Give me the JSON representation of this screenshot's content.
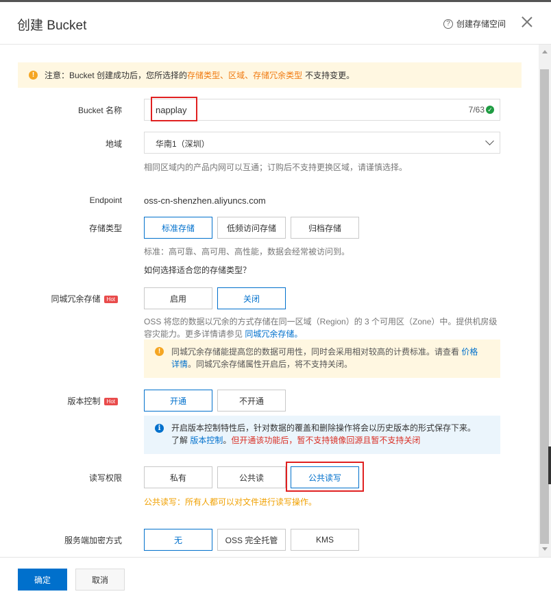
{
  "dialog": {
    "title": "创建 Bucket",
    "help_link": "创建存储空间",
    "help_icon": "?"
  },
  "notice": {
    "prefix": "注意：Bucket 创建成功后，您所选择的",
    "term1": "存储类型",
    "sep1": "、",
    "term2": "区域",
    "sep2": "、",
    "term3": "存储冗余类型",
    "suffix": "不支持变更。"
  },
  "bucket_name": {
    "label": "Bucket 名称",
    "value": "napplay",
    "counter": "7/63"
  },
  "region": {
    "label": "地域",
    "selected": "华南1（深圳）",
    "hint": "相同区域内的产品内网可以互通；订购后不支持更换区域，请谨慎选择。"
  },
  "endpoint": {
    "label": "Endpoint",
    "value": "oss-cn-shenzhen.aliyuncs.com"
  },
  "storage_class": {
    "label": "存储类型",
    "options": [
      "标准存储",
      "低频访问存储",
      "归档存储"
    ],
    "selected": "标准存储",
    "hint": "标准：高可靠、高可用、高性能，数据会经常被访问到。",
    "link": "如何选择适合您的存储类型？"
  },
  "zone_redundancy": {
    "label": "同城冗余存储",
    "hot": "Hot",
    "options": [
      "启用",
      "关闭"
    ],
    "selected": "关闭",
    "desc_line1": "OSS 将您的数据以冗余的方式存储在同一区域（Region）的 3 个可用区（Zone）中。提供机房级",
    "desc_line2": "容灾能力。更多详情请参见",
    "desc_link": "同城冗余存储。",
    "warn_text1": "同城冗余存储能提高您的数据可用性，同时会采用相对较高的计费标准。请查看",
    "warn_link1": "价格",
    "warn_link2": "详情",
    "warn_text2": "。同城冗余存储属性开启后，将不支持关闭。"
  },
  "versioning": {
    "label": "版本控制",
    "hot": "Hot",
    "options": [
      "开通",
      "不开通"
    ],
    "selected": "开通",
    "info_line1": "开启版本控制特性后，针对数据的覆盖和删除操作将会以历史版本的形式保存下来。",
    "info_prefix": "了解",
    "info_link": "版本控制",
    "info_sep": "。",
    "info_red": "但开通该功能后，暂不支持镜像回源且暂不支持关闭"
  },
  "acl": {
    "label": "读写权限",
    "options": [
      "私有",
      "公共读",
      "公共读写"
    ],
    "selected": "公共读写",
    "hint": "公共读写：所有人都可以对文件进行读写操作。"
  },
  "encryption": {
    "label": "服务端加密方式",
    "options": [
      "无",
      "OSS 完全托管",
      "KMS"
    ],
    "selected": "无"
  },
  "footer": {
    "confirm": "确定",
    "cancel": "取消"
  },
  "icons": {
    "warning": "!",
    "info": "i",
    "check": "✓"
  },
  "colors": {
    "primary": "#0070cc",
    "warning_bg": "#fff7e1",
    "info_bg": "#ebf5fc",
    "highlight": "#e02020",
    "hot": "#e94b4b"
  }
}
